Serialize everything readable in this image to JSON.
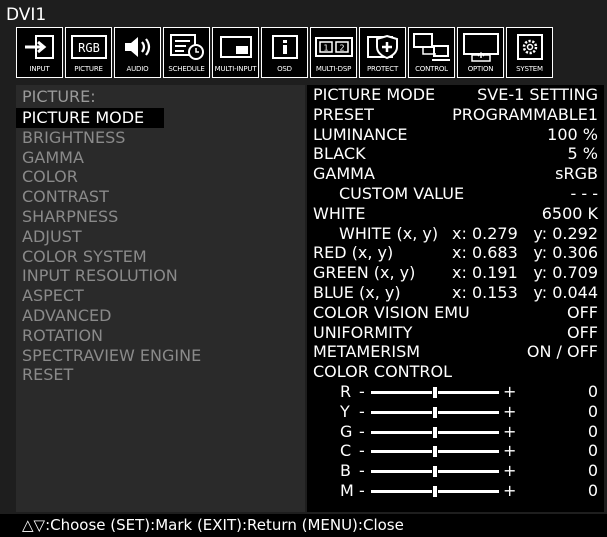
{
  "window": {
    "title": "DVI1"
  },
  "tabs": [
    {
      "label": "INPUT",
      "icon": "input-arrow-icon"
    },
    {
      "label": "PICTURE",
      "icon": "rgb-icon"
    },
    {
      "label": "AUDIO",
      "icon": "speaker-icon"
    },
    {
      "label": "SCHEDULE",
      "icon": "schedule-clock-icon"
    },
    {
      "label": "MULTI-INPUT",
      "icon": "pip-window-icon"
    },
    {
      "label": "OSD",
      "icon": "info-icon"
    },
    {
      "label": "MULTI-DSP",
      "icon": "multi-display-icon"
    },
    {
      "label": "PROTECT",
      "icon": "shield-plus-icon"
    },
    {
      "label": "CONTROL",
      "icon": "network-computers-icon"
    },
    {
      "label": "OPTION",
      "icon": "monitor-upload-icon"
    },
    {
      "label": "SYSTEM",
      "icon": "gear-icon"
    }
  ],
  "active_tab": "PICTURE",
  "menu": {
    "title": "PICTURE:",
    "items": [
      "PICTURE MODE",
      "BRIGHTNESS",
      "GAMMA",
      "COLOR",
      "CONTRAST",
      "SHARPNESS",
      "ADJUST",
      "COLOR SYSTEM",
      "INPUT RESOLUTION",
      "ASPECT",
      "ADVANCED",
      "ROTATION",
      "SPECTRAVIEW ENGINE",
      "RESET"
    ],
    "selected": "PICTURE MODE"
  },
  "panel": {
    "picture_mode": {
      "label": "PICTURE MODE",
      "value": "SVE-1 SETTING"
    },
    "preset": {
      "label": "PRESET",
      "value": "PROGRAMMABLE1"
    },
    "luminance": {
      "label": "LUMINANCE",
      "value": "100 %"
    },
    "black": {
      "label": "BLACK",
      "value": "5 %"
    },
    "gamma": {
      "label": "GAMMA",
      "value": "sRGB"
    },
    "custom_value": {
      "label": "CUSTOM VALUE",
      "value": "- - -"
    },
    "white": {
      "label": "WHITE",
      "value": "6500 K"
    },
    "white_xy": {
      "label": "WHITE (x, y)",
      "x": "x: 0.279",
      "y": "y: 0.292"
    },
    "red_xy": {
      "label": "RED (x, y)",
      "x": "x: 0.683",
      "y": "y: 0.306"
    },
    "green_xy": {
      "label": "GREEN (x, y)",
      "x": "x: 0.191",
      "y": "y: 0.709"
    },
    "blue_xy": {
      "label": "BLUE (x, y)",
      "x": "x: 0.153",
      "y": "y: 0.044"
    },
    "color_vision_emu": {
      "label": "COLOR VISION EMU",
      "value": "OFF"
    },
    "uniformity": {
      "label": "UNIFORMITY",
      "value": "OFF"
    },
    "metamerism": {
      "label": "METAMERISM",
      "value": "ON / OFF"
    },
    "color_control": {
      "label": "COLOR CONTROL"
    },
    "sliders": [
      {
        "name": "R",
        "minus": "-",
        "plus": "+",
        "value": "0",
        "level": 0.5
      },
      {
        "name": "Y",
        "minus": "-",
        "plus": "+",
        "value": "0",
        "level": 0.5
      },
      {
        "name": "G",
        "minus": "-",
        "plus": "+",
        "value": "0",
        "level": 0.5
      },
      {
        "name": "C",
        "minus": "-",
        "plus": "+",
        "value": "0",
        "level": 0.5
      },
      {
        "name": "B",
        "minus": "-",
        "plus": "+",
        "value": "0",
        "level": 0.5
      },
      {
        "name": "M",
        "minus": "-",
        "plus": "+",
        "value": "0",
        "level": 0.5
      }
    ]
  },
  "help": {
    "text": "△▽:Choose (SET):Mark (EXIT):Return (MENU):Close"
  },
  "colors": {
    "background": "#1e1e1e",
    "menu_bg": "#2a2a2a",
    "panel_bg": "#000000",
    "inactive_text": "#8a8a8a",
    "text": "#ffffff"
  }
}
